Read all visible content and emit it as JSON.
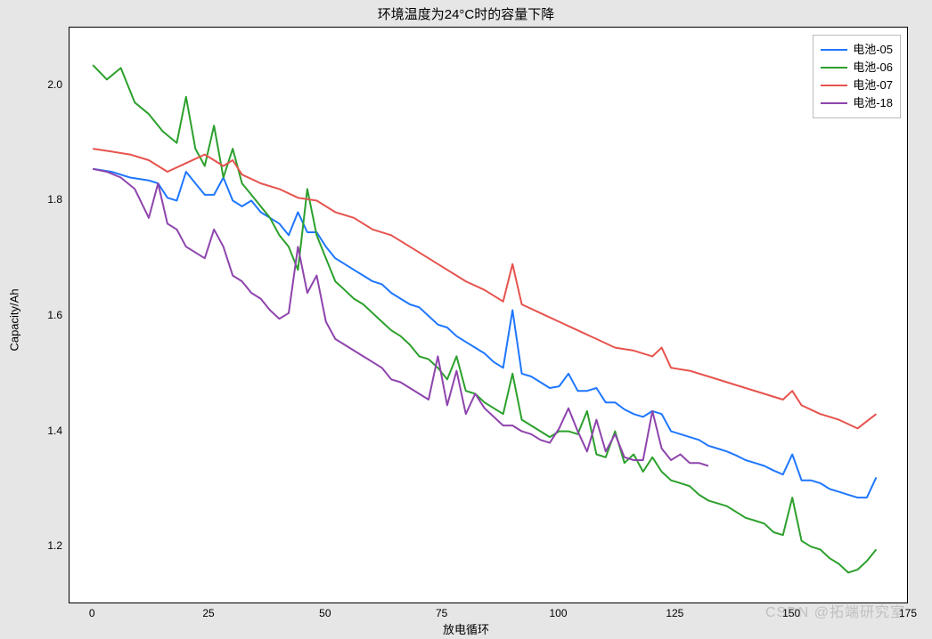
{
  "chart_data": {
    "type": "line",
    "title": "环境温度为24°C时的容量下降",
    "xlabel": "放电循环",
    "ylabel": "Capacity/Ah",
    "xlim": [
      -5,
      175
    ],
    "ylim": [
      1.1,
      2.1
    ],
    "xticks": [
      0,
      25,
      50,
      75,
      100,
      125,
      150,
      175
    ],
    "yticks": [
      1.2,
      1.4,
      1.6,
      1.8,
      2.0
    ],
    "series": [
      {
        "name": "电池-05",
        "color": "#1f77ff",
        "x": [
          0,
          4,
          8,
          12,
          14,
          16,
          18,
          20,
          22,
          24,
          26,
          28,
          30,
          32,
          34,
          36,
          38,
          40,
          42,
          44,
          46,
          48,
          50,
          52,
          54,
          56,
          58,
          60,
          62,
          64,
          66,
          68,
          70,
          72,
          74,
          76,
          78,
          80,
          82,
          84,
          86,
          88,
          90,
          92,
          94,
          96,
          98,
          100,
          102,
          104,
          106,
          108,
          110,
          112,
          114,
          116,
          118,
          120,
          122,
          124,
          126,
          128,
          130,
          132,
          134,
          136,
          138,
          140,
          142,
          144,
          146,
          148,
          150,
          152,
          154,
          156,
          158,
          160,
          162,
          164,
          166,
          168
        ],
        "y": [
          1.855,
          1.85,
          1.84,
          1.835,
          1.83,
          1.805,
          1.8,
          1.85,
          1.83,
          1.81,
          1.81,
          1.84,
          1.8,
          1.79,
          1.8,
          1.78,
          1.77,
          1.76,
          1.74,
          1.78,
          1.745,
          1.745,
          1.72,
          1.7,
          1.69,
          1.68,
          1.67,
          1.66,
          1.655,
          1.64,
          1.63,
          1.62,
          1.615,
          1.6,
          1.585,
          1.58,
          1.565,
          1.555,
          1.545,
          1.535,
          1.52,
          1.51,
          1.61,
          1.5,
          1.495,
          1.485,
          1.475,
          1.478,
          1.5,
          1.47,
          1.47,
          1.475,
          1.45,
          1.45,
          1.438,
          1.43,
          1.425,
          1.435,
          1.43,
          1.4,
          1.395,
          1.39,
          1.385,
          1.375,
          1.37,
          1.365,
          1.358,
          1.35,
          1.345,
          1.34,
          1.332,
          1.325,
          1.36,
          1.315,
          1.315,
          1.31,
          1.3,
          1.295,
          1.29,
          1.285,
          1.285,
          1.32
        ]
      },
      {
        "name": "电池-06",
        "color": "#2ca02c",
        "x": [
          0,
          3,
          6,
          9,
          12,
          15,
          18,
          20,
          22,
          24,
          26,
          28,
          30,
          32,
          34,
          36,
          38,
          40,
          42,
          44,
          46,
          48,
          50,
          52,
          54,
          56,
          58,
          60,
          62,
          64,
          66,
          68,
          70,
          72,
          74,
          76,
          78,
          80,
          82,
          84,
          86,
          88,
          90,
          92,
          94,
          96,
          98,
          100,
          102,
          104,
          106,
          108,
          110,
          112,
          114,
          116,
          118,
          120,
          122,
          124,
          126,
          128,
          130,
          132,
          134,
          136,
          138,
          140,
          142,
          144,
          146,
          148,
          150,
          152,
          154,
          156,
          158,
          160,
          162,
          164,
          166,
          168
        ],
        "y": [
          2.035,
          2.01,
          2.03,
          1.97,
          1.95,
          1.92,
          1.9,
          1.98,
          1.89,
          1.86,
          1.93,
          1.84,
          1.89,
          1.83,
          1.81,
          1.79,
          1.77,
          1.74,
          1.72,
          1.68,
          1.82,
          1.74,
          1.7,
          1.66,
          1.645,
          1.63,
          1.62,
          1.605,
          1.59,
          1.575,
          1.565,
          1.55,
          1.53,
          1.525,
          1.51,
          1.49,
          1.53,
          1.47,
          1.465,
          1.45,
          1.44,
          1.43,
          1.5,
          1.42,
          1.41,
          1.4,
          1.39,
          1.4,
          1.4,
          1.395,
          1.435,
          1.36,
          1.355,
          1.4,
          1.345,
          1.36,
          1.33,
          1.355,
          1.33,
          1.315,
          1.31,
          1.305,
          1.29,
          1.28,
          1.275,
          1.27,
          1.26,
          1.25,
          1.245,
          1.24,
          1.225,
          1.22,
          1.285,
          1.21,
          1.2,
          1.195,
          1.18,
          1.17,
          1.155,
          1.16,
          1.175,
          1.195
        ]
      },
      {
        "name": "电池-07",
        "color": "#e6534e",
        "x": [
          0,
          4,
          8,
          12,
          16,
          20,
          24,
          28,
          30,
          32,
          36,
          40,
          44,
          48,
          52,
          56,
          60,
          64,
          68,
          72,
          76,
          80,
          84,
          88,
          90,
          92,
          96,
          100,
          104,
          108,
          112,
          116,
          120,
          122,
          124,
          128,
          132,
          136,
          140,
          144,
          148,
          150,
          152,
          156,
          160,
          164,
          168
        ],
        "y": [
          1.89,
          1.885,
          1.88,
          1.87,
          1.85,
          1.865,
          1.88,
          1.86,
          1.87,
          1.845,
          1.83,
          1.82,
          1.805,
          1.8,
          1.78,
          1.77,
          1.75,
          1.74,
          1.72,
          1.7,
          1.68,
          1.66,
          1.645,
          1.625,
          1.69,
          1.62,
          1.605,
          1.59,
          1.575,
          1.56,
          1.545,
          1.54,
          1.53,
          1.545,
          1.51,
          1.505,
          1.495,
          1.485,
          1.475,
          1.465,
          1.455,
          1.47,
          1.445,
          1.43,
          1.42,
          1.405,
          1.43
        ]
      },
      {
        "name": "电池-18",
        "color": "#8e44ad",
        "x": [
          0,
          3,
          6,
          9,
          12,
          14,
          16,
          18,
          20,
          22,
          24,
          26,
          28,
          30,
          32,
          34,
          36,
          38,
          40,
          42,
          44,
          46,
          48,
          50,
          52,
          54,
          56,
          58,
          60,
          62,
          64,
          66,
          68,
          70,
          72,
          74,
          76,
          78,
          80,
          82,
          84,
          86,
          88,
          90,
          92,
          94,
          96,
          98,
          100,
          102,
          104,
          106,
          108,
          110,
          112,
          114,
          116,
          118,
          120,
          122,
          124,
          126,
          128,
          130,
          132
        ],
        "y": [
          1.855,
          1.85,
          1.84,
          1.82,
          1.77,
          1.83,
          1.76,
          1.75,
          1.72,
          1.71,
          1.7,
          1.75,
          1.72,
          1.67,
          1.66,
          1.64,
          1.63,
          1.61,
          1.595,
          1.605,
          1.72,
          1.64,
          1.67,
          1.59,
          1.56,
          1.55,
          1.54,
          1.53,
          1.52,
          1.51,
          1.49,
          1.485,
          1.475,
          1.465,
          1.455,
          1.53,
          1.445,
          1.505,
          1.43,
          1.465,
          1.44,
          1.425,
          1.41,
          1.41,
          1.4,
          1.395,
          1.385,
          1.38,
          1.405,
          1.44,
          1.4,
          1.365,
          1.42,
          1.365,
          1.395,
          1.355,
          1.35,
          1.35,
          1.435,
          1.37,
          1.35,
          1.36,
          1.345,
          1.345,
          1.34
        ]
      }
    ]
  },
  "watermark": "CSDN @拓端研究室"
}
